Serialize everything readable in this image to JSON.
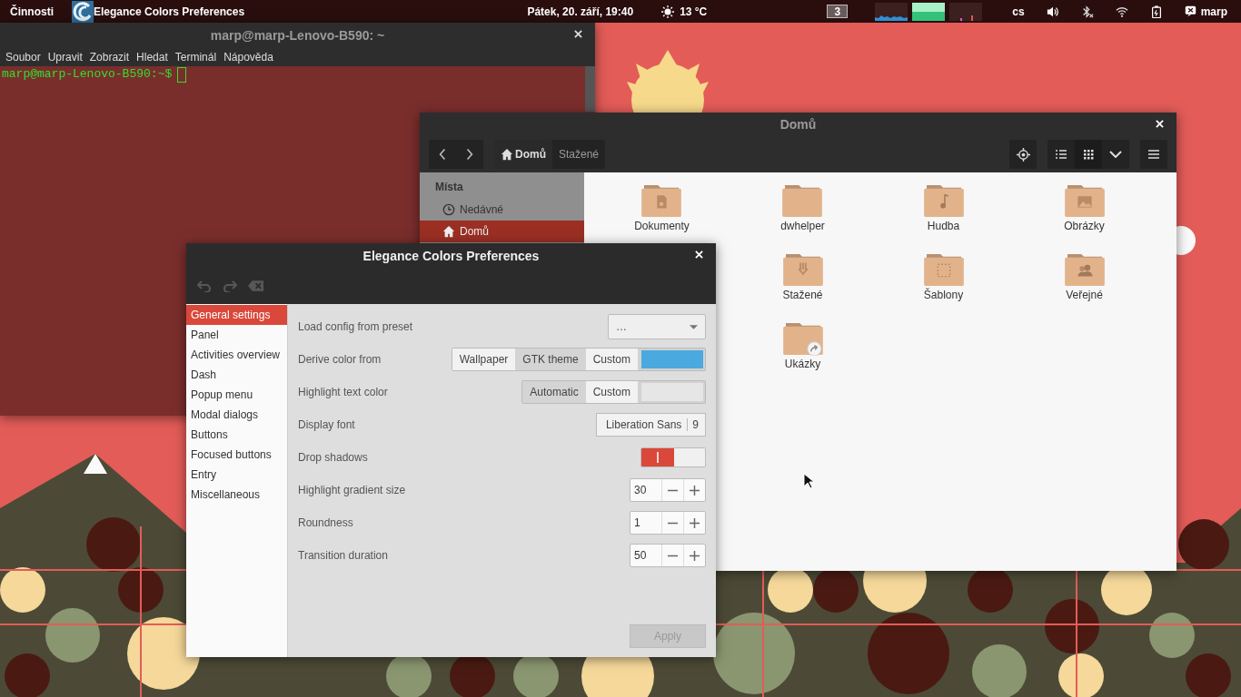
{
  "top_bar": {
    "activities": "Činnosti",
    "app_menu": "Elegance Colors Preferences",
    "clock": "Pátek, 20. září, 19:40",
    "weather": "13 °C",
    "workspace": "3",
    "keyboard_layout": "cs",
    "user": "marp"
  },
  "terminal": {
    "title": "marp@marp-Lenovo-B590: ~",
    "menu": [
      "Soubor",
      "Upravit",
      "Zobrazit",
      "Hledat",
      "Terminál",
      "Nápověda"
    ],
    "prompt": "marp@marp-Lenovo-B590:~$"
  },
  "files": {
    "title": "Domů",
    "path": [
      {
        "label": "Domů",
        "selected": true
      },
      {
        "label": "Stažené",
        "selected": false
      }
    ],
    "sidebar": {
      "heading": "Místa",
      "items": [
        {
          "label": "Nedávné",
          "kind": "recent",
          "selected": false
        },
        {
          "label": "Domů",
          "kind": "home",
          "selected": true
        }
      ]
    },
    "folders": [
      {
        "name": "Dokumenty",
        "kind": "documents"
      },
      {
        "name": "dwhelper",
        "kind": "plain"
      },
      {
        "name": "Hudba",
        "kind": "music"
      },
      {
        "name": "Obrázky",
        "kind": "pictures"
      },
      {
        "name": "Stažené",
        "kind": "downloads"
      },
      {
        "name": "Šablony",
        "kind": "templates"
      },
      {
        "name": "Veřejné",
        "kind": "public"
      },
      {
        "name": "Ukázky",
        "kind": "link"
      }
    ]
  },
  "preferences": {
    "title": "Elegance Colors Preferences",
    "toolbar": [
      {
        "kind": "undo",
        "disabled": true
      },
      {
        "kind": "redo",
        "disabled": true
      },
      {
        "kind": "clear",
        "disabled": true
      }
    ],
    "categories": [
      {
        "label": "General settings",
        "selected": true
      },
      {
        "label": "Panel",
        "selected": false
      },
      {
        "label": "Activities overview",
        "selected": false
      },
      {
        "label": "Dash",
        "selected": false
      },
      {
        "label": "Popup menu",
        "selected": false
      },
      {
        "label": "Modal dialogs",
        "selected": false
      },
      {
        "label": "Buttons",
        "selected": false
      },
      {
        "label": "Focused buttons",
        "selected": false
      },
      {
        "label": "Entry",
        "selected": false
      },
      {
        "label": "Miscellaneous",
        "selected": false
      }
    ],
    "settings": [
      {
        "label": "Load config from preset",
        "kind": "dropdown",
        "value": "…"
      },
      {
        "label": "Derive color from",
        "kind": "choice",
        "options": [
          {
            "label": "Wallpaper",
            "selected": false
          },
          {
            "label": "GTK theme",
            "selected": true
          },
          {
            "label": "Custom",
            "selected": false
          }
        ],
        "color": "#4ba9e0"
      },
      {
        "label": "Highlight text color",
        "kind": "choice",
        "options": [
          {
            "label": "Automatic",
            "selected": true
          },
          {
            "label": "Custom",
            "selected": false
          }
        ],
        "color": "#e6e6e6"
      },
      {
        "label": "Display font",
        "kind": "font",
        "family": "Liberation Sans",
        "size": "9"
      },
      {
        "label": "Drop shadows",
        "kind": "switch",
        "on": true
      },
      {
        "label": "Highlight gradient size",
        "kind": "spin",
        "value": "30"
      },
      {
        "label": "Roundness",
        "kind": "spin",
        "value": "1"
      },
      {
        "label": "Transition duration",
        "kind": "spin",
        "value": "50"
      }
    ],
    "apply": {
      "label": "Apply",
      "disabled": true
    }
  }
}
